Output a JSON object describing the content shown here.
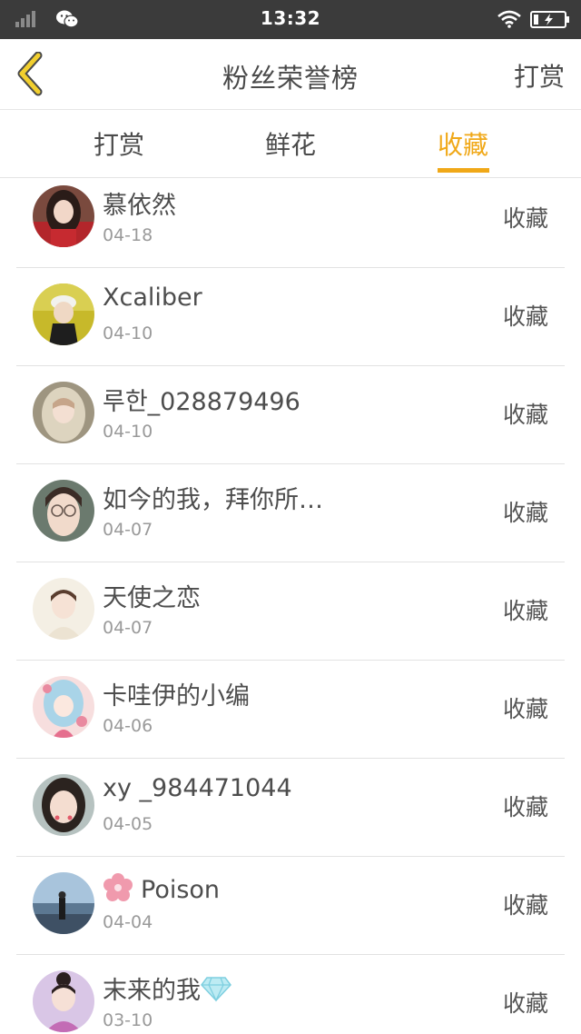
{
  "status_bar": {
    "time": "13:32",
    "icons": [
      "signal-icon",
      "wechat-icon",
      "wifi-icon",
      "battery-charging-icon"
    ]
  },
  "header": {
    "back_icon": "chevron-left-icon",
    "title": "粉丝荣誉榜",
    "action_label": "打赏"
  },
  "tabs": [
    {
      "label": "打赏",
      "active": false
    },
    {
      "label": "鲜花",
      "active": false
    },
    {
      "label": "收藏",
      "active": true
    }
  ],
  "colors": {
    "accent": "#f0a818",
    "status_bar_bg": "#3b3b3b",
    "text": "#4a4a4a",
    "date_text": "#9a9a9a",
    "divider": "#e2e2e2"
  },
  "fans": [
    {
      "name": "慕依然",
      "date": "04-18",
      "type": "收藏",
      "avatar": "avatar-girl-red-dress"
    },
    {
      "name": "Xcaliber",
      "date": "04-10",
      "type": "收藏",
      "avatar": "avatar-girl-white-cap"
    },
    {
      "name": "루한_028879496",
      "date": "04-10",
      "type": "收藏",
      "avatar": "avatar-girl-hood"
    },
    {
      "name": "如今的我，拜你所…",
      "date": "04-07",
      "type": "收藏",
      "avatar": "avatar-girl-glasses"
    },
    {
      "name": "天使之恋",
      "date": "04-07",
      "type": "收藏",
      "avatar": "avatar-boy-light"
    },
    {
      "name": "卡哇伊的小编",
      "date": "04-06",
      "type": "收藏",
      "avatar": "avatar-anime-girl"
    },
    {
      "name": "xy _984471044",
      "date": "04-05",
      "type": "收藏",
      "avatar": "avatar-girl-portrait"
    },
    {
      "name": "Poison",
      "date": "04-04",
      "type": "收藏",
      "avatar": "avatar-lake-scene",
      "name_icon": "flower-icon"
    },
    {
      "name": "末来的我",
      "date": "03-10",
      "type": "收藏",
      "avatar": "avatar-girl-bun",
      "name_icon_after": "diamond-icon"
    }
  ]
}
